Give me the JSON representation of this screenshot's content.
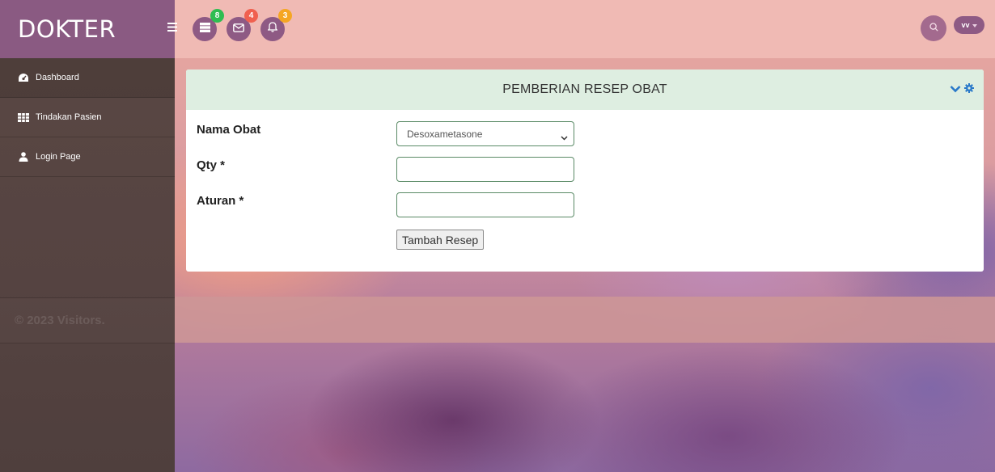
{
  "brand": {
    "title": "DOKTER"
  },
  "sidebar": {
    "items": [
      {
        "label": "Dashboard",
        "icon": "dashboard-icon"
      },
      {
        "label": "Tindakan Pasien",
        "icon": "table-icon"
      },
      {
        "label": "Login Page",
        "icon": "user-icon"
      }
    ],
    "footer": "© 2023 Visitors."
  },
  "topbar": {
    "badges": {
      "tasks": "8",
      "messages": "4",
      "notifications": "3"
    },
    "badge_colors": {
      "tasks": "#2ebd52",
      "messages": "#f0604f",
      "notifications": "#f5a623"
    },
    "user_initials": "vv"
  },
  "card": {
    "title": "PEMBERIAN RESEP OBAT",
    "form": {
      "nama_obat_label": "Nama Obat",
      "nama_obat_value": "Desoxametasone",
      "qty_label": "Qty *",
      "qty_value": "",
      "aturan_label": "Aturan *",
      "aturan_value": "",
      "submit_label": "Tambah Resep"
    }
  },
  "colors": {
    "accent": "#8e5a84",
    "sidebar": "#554341",
    "topbar": "#f0bab4",
    "card_header": "#deeee1"
  }
}
